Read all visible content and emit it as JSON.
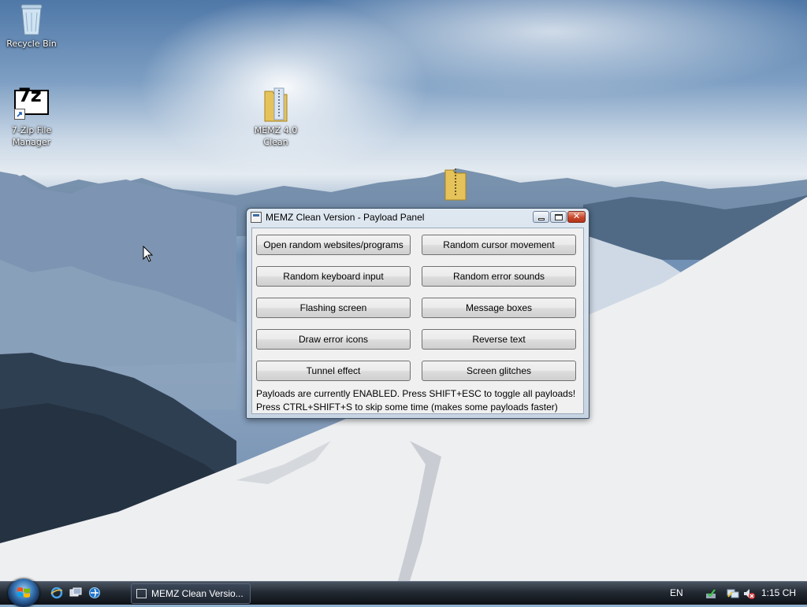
{
  "desktop": {
    "icons": [
      {
        "label_lines": [
          "Recycle Bin"
        ],
        "icon": "recycle-bin-icon"
      },
      {
        "label_lines": [
          "7-Zip File",
          "Manager"
        ],
        "icon": "7zip-icon"
      },
      {
        "label_lines": [
          "MEMZ 4.0",
          "Clean"
        ],
        "icon": "zip-folder-icon"
      },
      {
        "label_lines": [],
        "icon": "zip-folder-icon"
      }
    ],
    "seven_zip_logo": "7z"
  },
  "window": {
    "title": "MEMZ Clean Version - Payload Panel",
    "buttons": [
      "Open random websites/programs",
      "Random cursor movement",
      "Random keyboard input",
      "Random error sounds",
      "Flashing screen",
      "Message boxes",
      "Draw error icons",
      "Reverse text",
      "Tunnel effect",
      "Screen glitches"
    ],
    "status_line_1": "Payloads are currently ENABLED. Press SHIFT+ESC to toggle all payloads!",
    "status_line_2": "Press CTRL+SHIFT+S to skip some time (makes some payloads faster)"
  },
  "taskbar": {
    "task_label": "MEMZ Clean Versio...",
    "language": "EN",
    "clock": "1:15 CH",
    "quick_launch": [
      "ie-icon",
      "show-desktop-icon",
      "switch-windows-icon"
    ],
    "tray_icons": [
      "windows-update-icon",
      "network-icon",
      "volume-muted-icon"
    ]
  }
}
